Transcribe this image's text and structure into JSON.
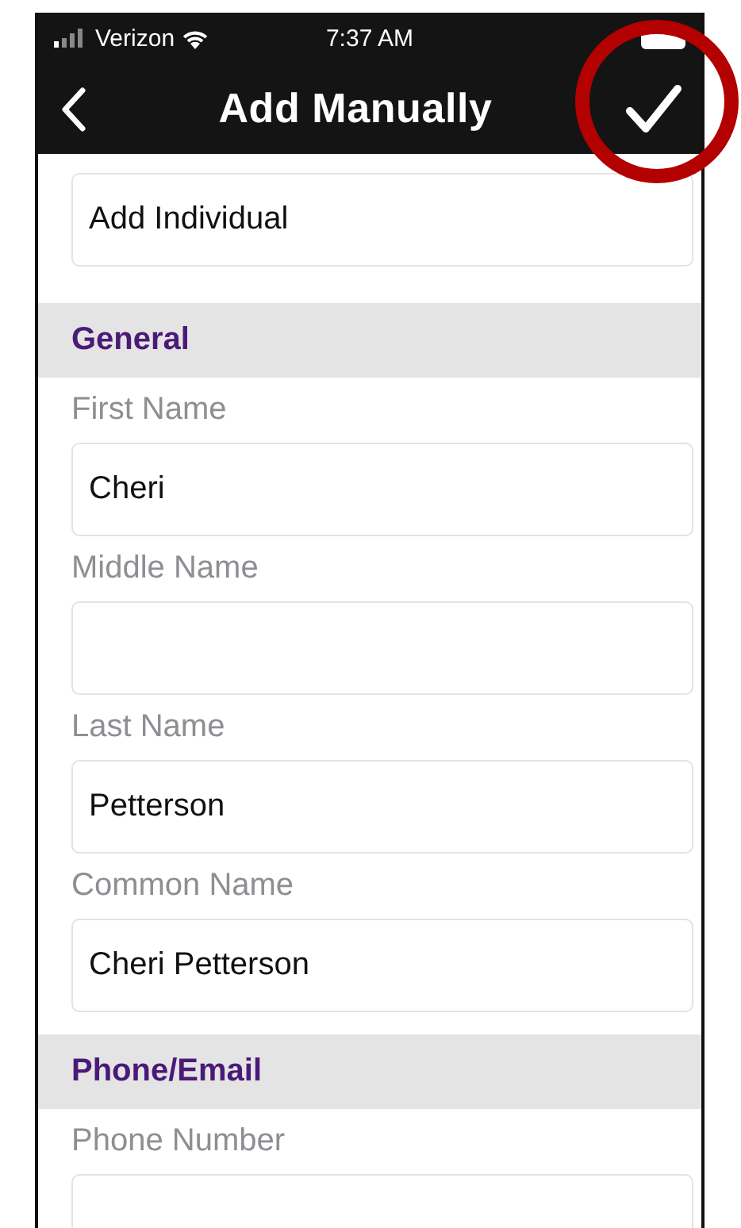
{
  "status_bar": {
    "carrier": "Verizon",
    "time": "7:37 AM"
  },
  "nav": {
    "title": "Add Manually"
  },
  "entry_type": {
    "value": "Add Individual"
  },
  "sections": [
    {
      "title": "General",
      "fields": [
        {
          "label": "First Name",
          "value": "Cheri"
        },
        {
          "label": "Middle Name"
        },
        {
          "label": "Last Name",
          "value": "Petterson"
        },
        {
          "label": "Common Name",
          "value": "Cheri Petterson"
        }
      ]
    },
    {
      "title": "Phone/Email",
      "fields": [
        {
          "label": "Phone Number"
        }
      ]
    }
  ]
}
